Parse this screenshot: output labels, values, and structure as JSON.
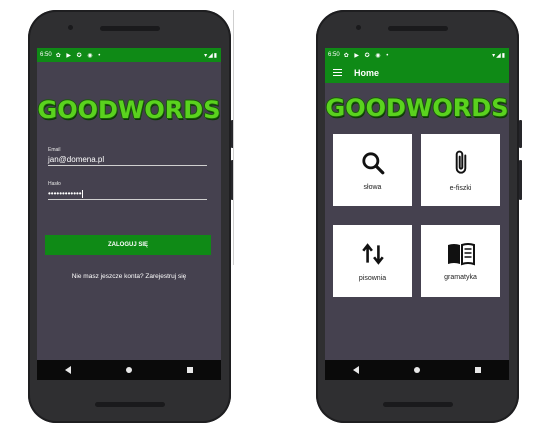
{
  "left_phone": {
    "status": {
      "time": "6:50",
      "icons": "✿ ▶ ✪ ◉ •",
      "right": "▾◢▮"
    },
    "logo": "GOODWORDS",
    "email": {
      "label": "Email",
      "value": "jan@domena.pl"
    },
    "password": {
      "label": "Hasło",
      "value": "••••••••••••"
    },
    "login_button": "ZALOGUJ SIĘ",
    "register_text": "Nie masz jeszcze konta? Zarejestruj się"
  },
  "right_phone": {
    "status": {
      "time": "6:50",
      "icons": "✿ ▶ ✪ ◉ •",
      "right": "▾◢▮"
    },
    "appbar_title": "Home",
    "logo": "GOODWORDS",
    "tiles": [
      {
        "label": "słowa",
        "icon": "search-icon"
      },
      {
        "label": "e-fiszki",
        "icon": "paperclip-icon"
      },
      {
        "label": "pisownia",
        "icon": "swap-vertical-icon"
      },
      {
        "label": "gramatyka",
        "icon": "book-icon"
      }
    ]
  },
  "colors": {
    "accent": "#0f8a16",
    "screen_bg": "#45414f",
    "logo_green": "#5ad21e"
  }
}
